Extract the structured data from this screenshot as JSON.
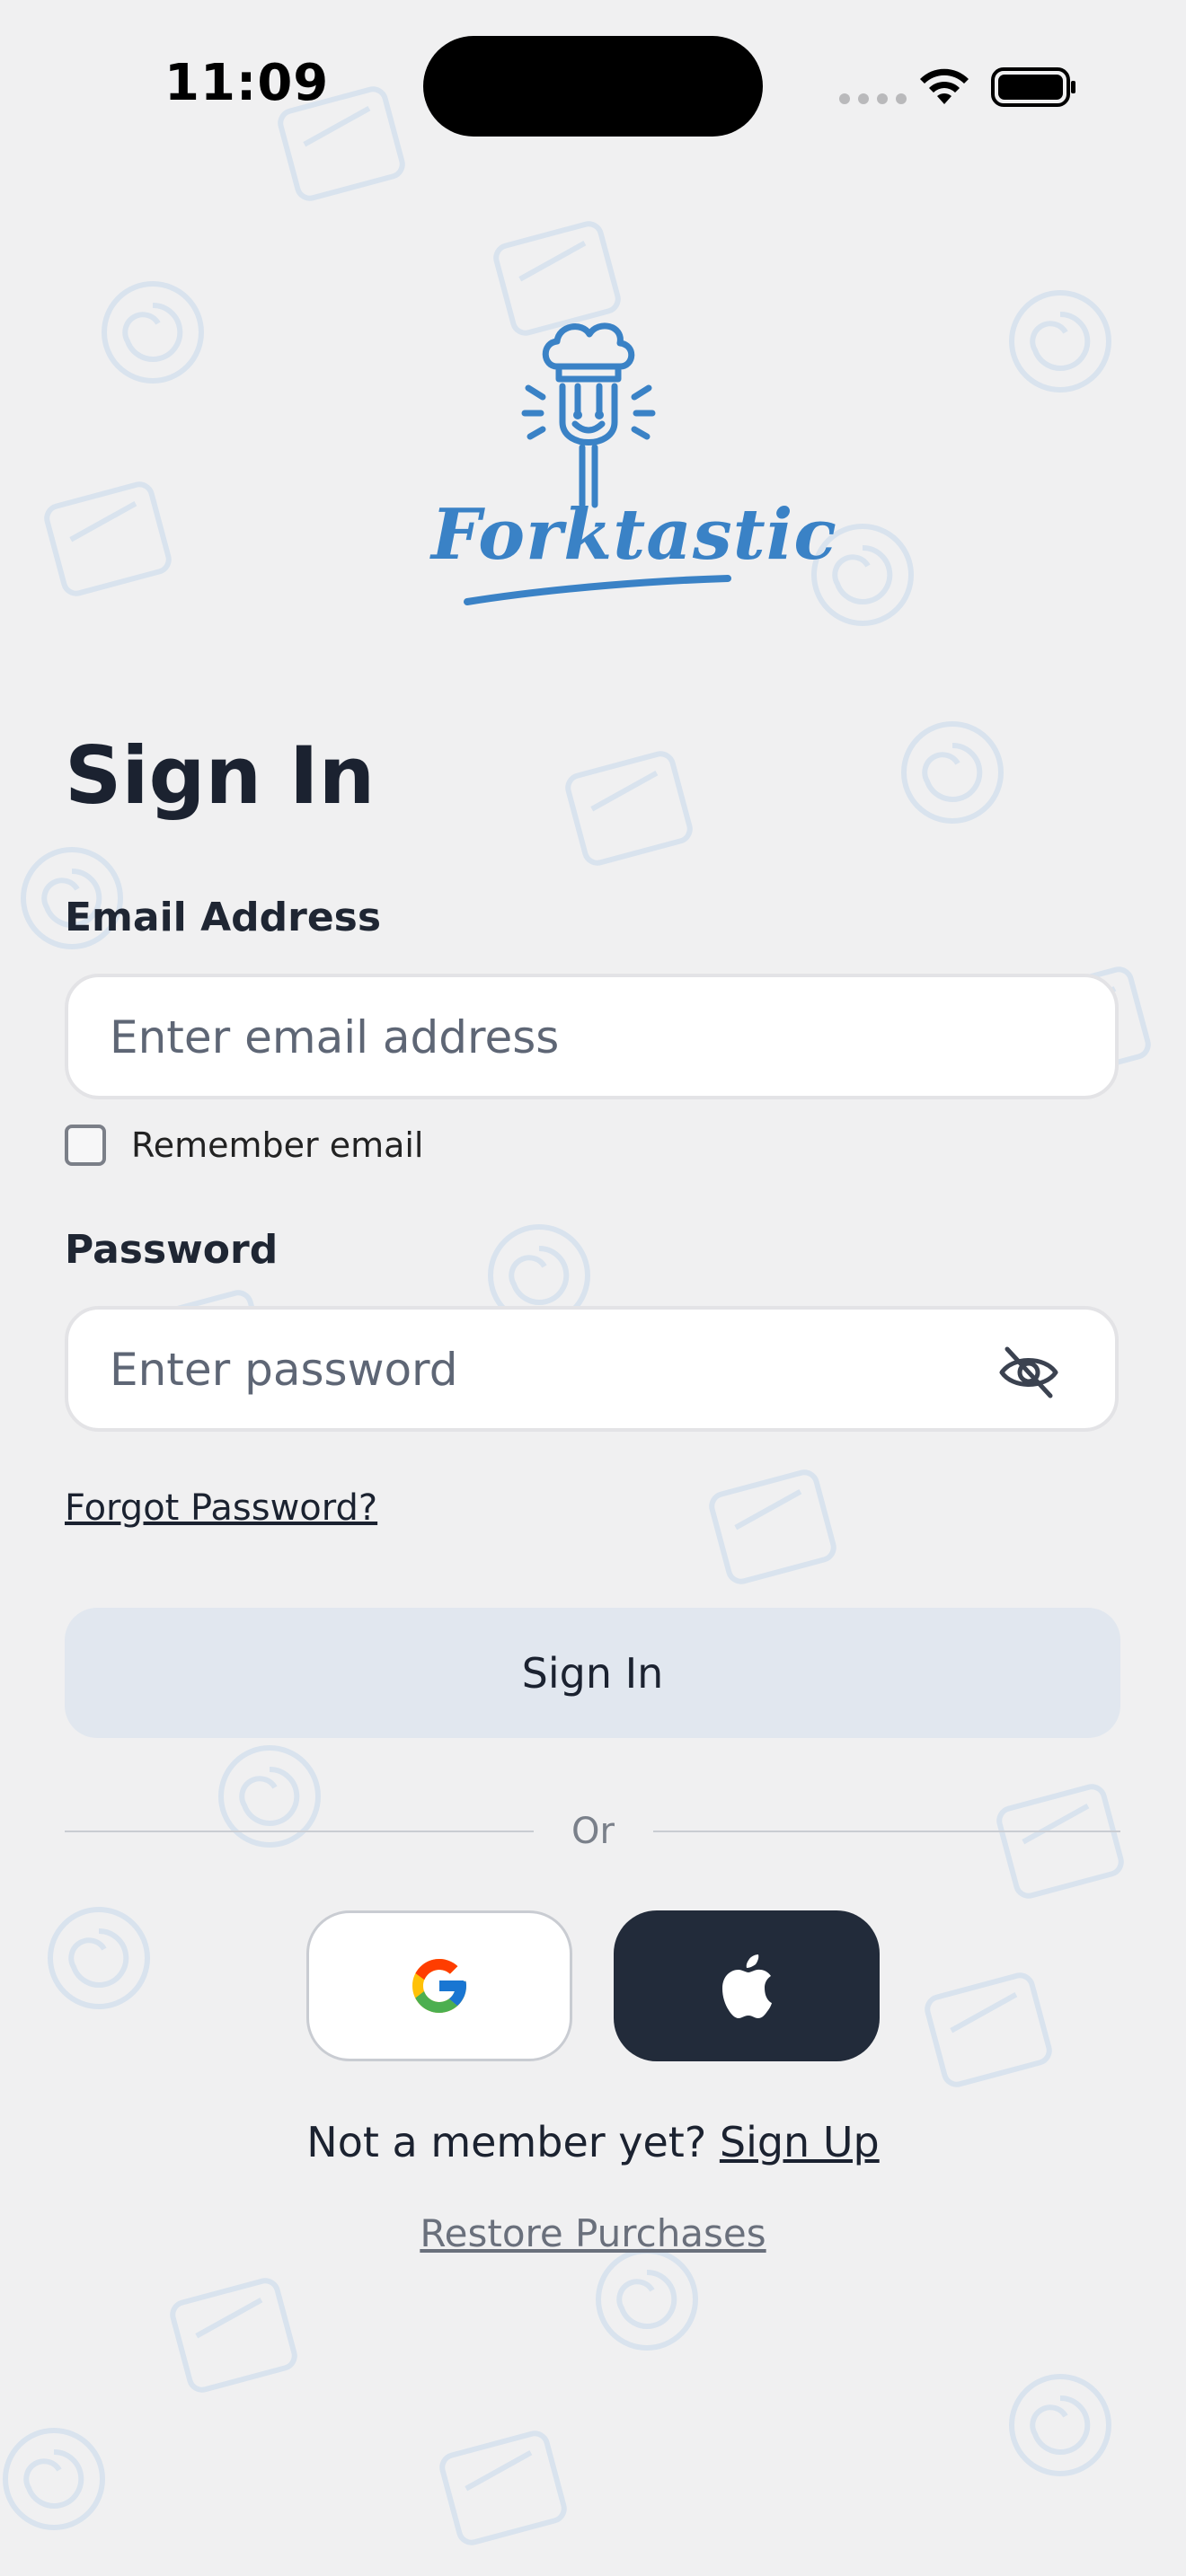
{
  "status_bar": {
    "time": "11:09"
  },
  "brand": {
    "name": "Forktastic",
    "color": "#3a82c6"
  },
  "page": {
    "title": "Sign In"
  },
  "email": {
    "label": "Email Address",
    "placeholder": "Enter email address",
    "value": ""
  },
  "remember": {
    "label": "Remember email",
    "checked": false
  },
  "password": {
    "label": "Password",
    "placeholder": "Enter password",
    "value": "",
    "visibility_icon": "eye-off-icon"
  },
  "links": {
    "forgot": "Forgot Password?",
    "restore": "Restore Purchases"
  },
  "signin_button": {
    "label": "Sign In"
  },
  "divider": {
    "text": "Or"
  },
  "social": {
    "google_icon": "google-icon",
    "apple_icon": "apple-icon"
  },
  "signup": {
    "prompt": "Not a member yet?",
    "link": "Sign Up"
  },
  "colors": {
    "background": "#f0f0f1",
    "dark_button": "#222b3a",
    "primary_button": "#e1e7ef",
    "text": "#1b2230"
  }
}
